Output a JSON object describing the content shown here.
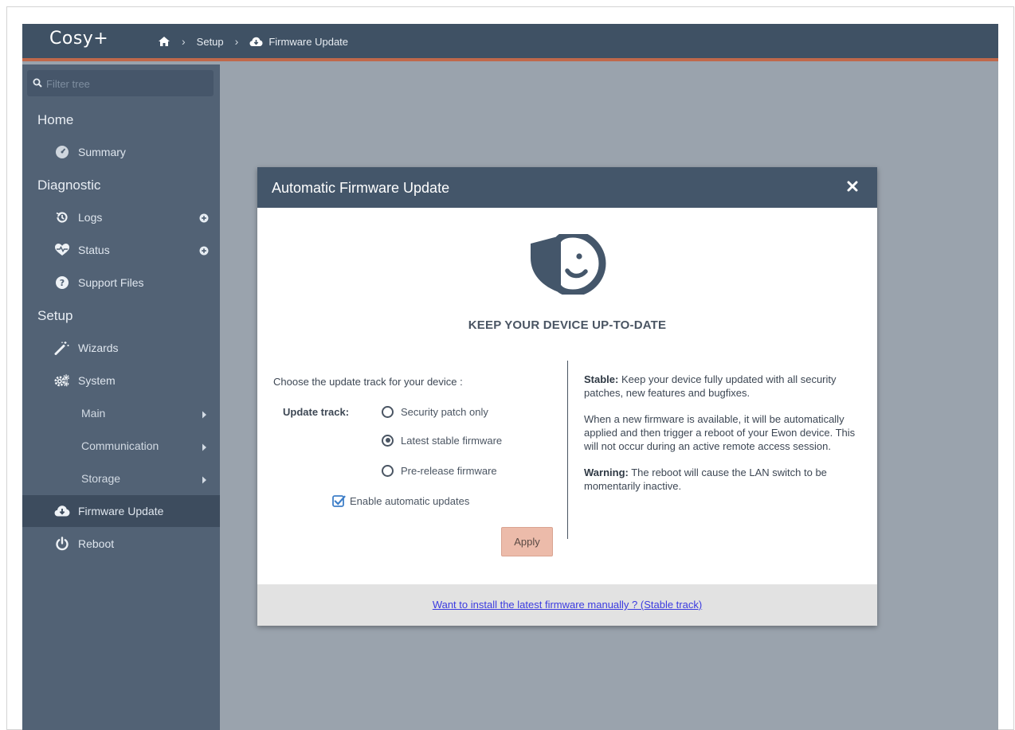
{
  "app": {
    "brand": "Cosy+",
    "breadcrumb": {
      "home_icon": "home-icon",
      "setup": "Setup",
      "current_icon": "cloud-download-icon",
      "current": "Firmware Update"
    }
  },
  "sidebar": {
    "filter_placeholder": "Filter tree",
    "sections": {
      "home": "Home",
      "diagnostic": "Diagnostic",
      "setup": "Setup"
    },
    "items": {
      "summary": "Summary",
      "logs": "Logs",
      "status": "Status",
      "support_files": "Support Files",
      "wizards": "Wizards",
      "system": "System",
      "main": "Main",
      "communication": "Communication",
      "storage": "Storage",
      "firmware_update": "Firmware Update",
      "reboot": "Reboot"
    }
  },
  "modal": {
    "title": "Automatic Firmware Update",
    "heading": "KEEP YOUR DEVICE UP-TO-DATE",
    "choose_text": "Choose the update track for your device :",
    "track_label": "Update track:",
    "options": [
      "Security patch only",
      "Latest stable firmware",
      "Pre-release firmware"
    ],
    "selected_option": "Latest stable firmware",
    "auto_update_label": "Enable automatic updates",
    "auto_update_checked": true,
    "apply_label": "Apply",
    "info": {
      "stable_title": "Stable:",
      "stable_text": "Keep your device fully updated with all security patches, new features and bugfixes.",
      "paragraph2": "When a new firmware is available, it will be automatically applied and then trigger a reboot of your Ewon device. This will not occur during an active remote access session.",
      "warning_title": "Warning:",
      "warning_text": "The reboot will cause the LAN switch to be momentarily inactive."
    },
    "footer_link": "Want to install the latest firmware manually ? (Stable track)"
  },
  "colors": {
    "topbar": "#3f5164",
    "accent_line": "#c0684a",
    "sidebar": "#526275",
    "modal_header": "#44566a",
    "apply_button": "#ecbbaa"
  }
}
